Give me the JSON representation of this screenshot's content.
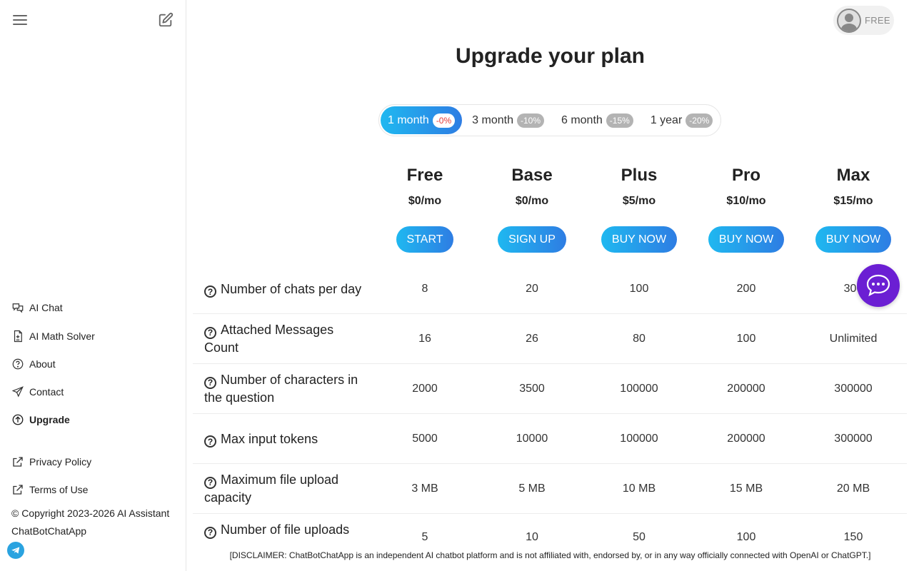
{
  "sidebar": {
    "nav": [
      {
        "label": "AI Chat",
        "icon": "chat-bubbles-icon"
      },
      {
        "label": "AI Math Solver",
        "icon": "math-file-icon"
      },
      {
        "label": "About",
        "icon": "question-circle-icon"
      },
      {
        "label": "Contact",
        "icon": "paper-plane-icon"
      },
      {
        "label": "Upgrade",
        "icon": "upgrade-arrow-icon",
        "active": true
      }
    ],
    "links": [
      {
        "label": "Privacy Policy",
        "icon": "external-link-icon"
      },
      {
        "label": "Terms of Use",
        "icon": "external-link-icon"
      }
    ],
    "copyright": "© Copyright 2023-2026 AI Assistant ChatBotChatApp"
  },
  "account": {
    "plan": "FREE"
  },
  "title": "Upgrade your plan",
  "periods": [
    {
      "label": "1 month",
      "discount": "-0%",
      "active": true
    },
    {
      "label": "3 month",
      "discount": "-10%"
    },
    {
      "label": "6 month",
      "discount": "-15%"
    },
    {
      "label": "1 year",
      "discount": "-20%"
    }
  ],
  "plans": [
    {
      "name": "Free",
      "price": "$0/mo",
      "button": "START"
    },
    {
      "name": "Base",
      "price": "$0/mo",
      "button": "SIGN UP"
    },
    {
      "name": "Plus",
      "price": "$5/mo",
      "button": "BUY NOW"
    },
    {
      "name": "Pro",
      "price": "$10/mo",
      "button": "BUY NOW"
    },
    {
      "name": "Max",
      "price": "$15/mo",
      "button": "BUY NOW"
    }
  ],
  "features": [
    {
      "label": "Number of chats per day",
      "values": [
        "8",
        "20",
        "100",
        "200",
        "300"
      ]
    },
    {
      "label": "Attached Messages Count",
      "values": [
        "16",
        "26",
        "80",
        "100",
        "Unlimited"
      ]
    },
    {
      "label": "Number of characters in the question",
      "values": [
        "2000",
        "3500",
        "100000",
        "200000",
        "300000"
      ]
    },
    {
      "label": "Max input tokens",
      "values": [
        "5000",
        "10000",
        "100000",
        "200000",
        "300000"
      ]
    },
    {
      "label": "Maximum file upload capacity",
      "values": [
        "3 MB",
        "5 MB",
        "10 MB",
        "15 MB",
        "20 MB"
      ]
    },
    {
      "label": "Number of file uploads",
      "values": [
        "5",
        "10",
        "50",
        "100",
        "150"
      ]
    }
  ],
  "disclaimer": "[DISCLAIMER: ChatBotChatApp is an independent AI chatbot platform and is not affiliated with, endorsed by, or in any way officially connected with OpenAI or ChatGPT.]",
  "colors": {
    "accent_start": "#1fb8f0",
    "accent_end": "#2e7de3",
    "chat_fab": "#6b1fd3",
    "discount_active": "#e53935"
  }
}
